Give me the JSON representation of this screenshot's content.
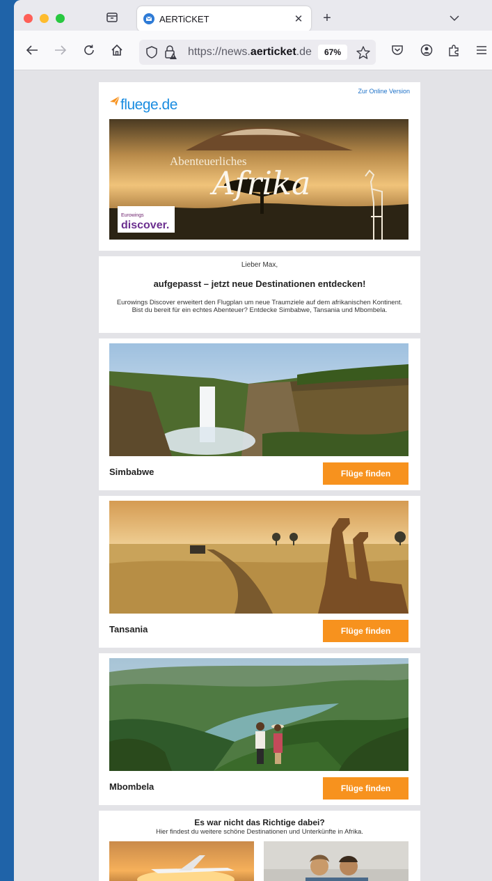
{
  "browser": {
    "tab_title": "AERTiCKET",
    "url_prefix": "https://news.",
    "url_domain": "aerticket",
    "url_suffix": ".de",
    "zoom": "67%"
  },
  "email": {
    "online_version": "Zur Online Version",
    "logo_fluege": "fluege",
    "logo_de": ".de",
    "hero_line1": "Abenteuerliches",
    "hero_line2": "Afrika",
    "eurowings": "Eurowings",
    "discover": "discover.",
    "greeting": "Lieber Max,",
    "headline": "aufgepasst – jetzt neue Destinationen entdecken!",
    "intro": "Eurowings Discover erweitert den Flugplan um neue Traumziele auf dem afrikanischen Kontinent. Bist du bereit für ein echtes Abenteuer? Entdecke Simbabwe, Tansania und Mbombela.",
    "destinations": [
      {
        "name": "Simbabwe",
        "button": "Flüge finden"
      },
      {
        "name": "Tansania",
        "button": "Flüge finden"
      },
      {
        "name": "Mbombela",
        "button": "Flüge finden"
      }
    ],
    "footer_title": "Es war nicht das Richtige dabei?",
    "footer_sub": "Hier findest du weitere schöne Destinationen und Unterkünfte in Afrika."
  },
  "colors": {
    "accent": "#f7921e",
    "window_bg": "#1f63a8",
    "brand_blue": "#1a8ce0"
  }
}
